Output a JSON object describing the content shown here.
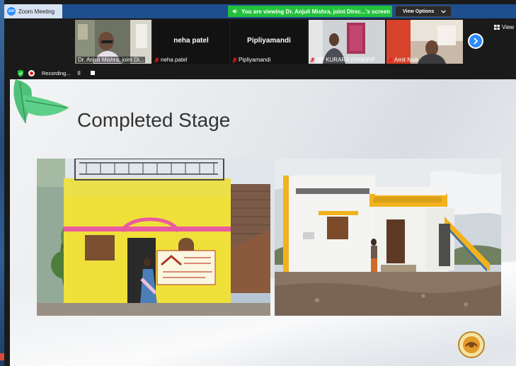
{
  "window": {
    "title": "Zoom Meeting",
    "banner_text": "You are viewing Dr. Anjuli Mishra, joint Direc...'s screen",
    "view_options_label": "View Options",
    "view_label": "View"
  },
  "participants": [
    {
      "name": "Dr. Anjuli Mishra, joint Di...",
      "video": true,
      "muted": false
    },
    {
      "name": "neha patel",
      "video": false,
      "muted": true,
      "display_name": "neha patel"
    },
    {
      "name": "Pipliyamandi",
      "video": false,
      "muted": true,
      "display_name": "Pipliyamandi"
    },
    {
      "name": "NP KURARA (HAM)RP...",
      "video": true,
      "muted": true
    },
    {
      "name": "Amit Naik",
      "video": true,
      "muted": true
    }
  ],
  "recording": {
    "label": "Recording...",
    "pause_symbol": "II"
  },
  "slide": {
    "title": "Completed Stage",
    "house_sign_text": "",
    "watermark_lines": [
      "",
      ""
    ]
  },
  "colors": {
    "zoom_blue": "#2d8cff",
    "banner_green": "#22c13c",
    "titlebar_blue": "#1f4e8f",
    "mute_red": "#e02020",
    "leaf_green": "#4fc07a"
  }
}
